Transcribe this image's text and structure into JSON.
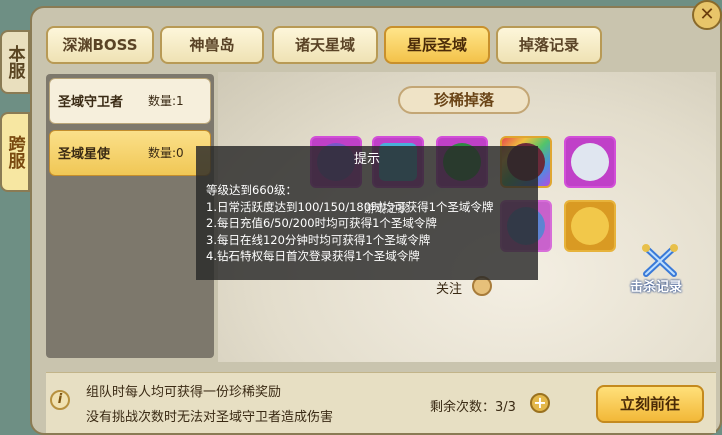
{
  "side_tabs": [
    {
      "label": "本服"
    },
    {
      "label": "跨服"
    }
  ],
  "tabs": [
    {
      "label": "深渊BOSS"
    },
    {
      "label": "神兽岛"
    },
    {
      "label": "诸天星域"
    },
    {
      "label": "星辰圣域"
    },
    {
      "label": "掉落记录"
    }
  ],
  "active_tab": "星辰圣域",
  "list": [
    {
      "name": "圣域守卫者",
      "qty": "数量:1"
    },
    {
      "name": "圣域星使",
      "qty": "数量:0"
    }
  ],
  "rare_drop": {
    "title": "珍稀掉落"
  },
  "popup": {
    "title": "提示",
    "lines": [
      "等级达到660级：",
      "1.日常活跃度达到100/150/180时均可获得1个圣域令牌",
      "2.每日充值6/50/200时均可获得1个圣域令牌",
      "3.每日在线120分钟时均可获得1个圣域令牌",
      "4.钻石特权每日首次登录获得1个圣域令牌"
    ]
  },
  "watermark": "游戏之家",
  "follow_label": "关注",
  "record_label": "击杀记录",
  "tips": [
    "组队时每人均可获得一份珍稀奖励",
    "没有挑战次数时无法对圣域守卫者造成伤害"
  ],
  "remaining": "剩余次数：3/3",
  "go_button": "立刻前往",
  "icons": {
    "close": "close-icon",
    "info": "info-icon",
    "plus": "plus-icon",
    "record": "crossed-swords-icon"
  }
}
